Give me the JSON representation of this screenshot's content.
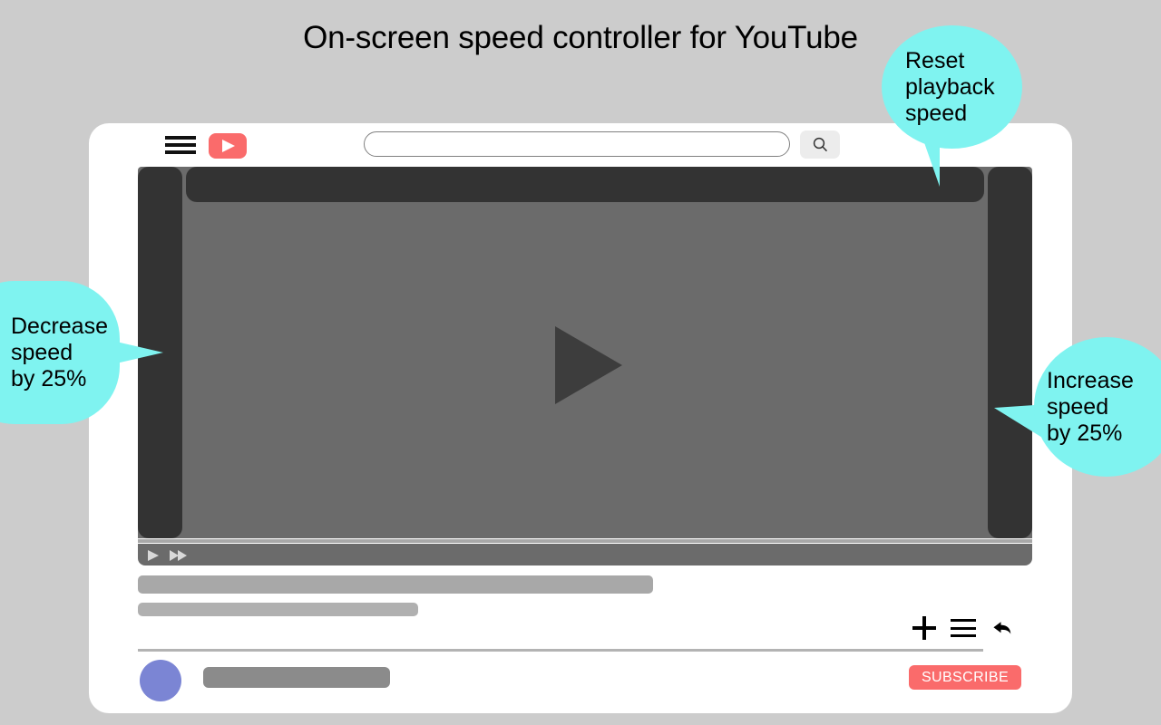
{
  "page": {
    "title": "On-screen speed controller for YouTube",
    "background_color": "#cccccc"
  },
  "colors": {
    "accent_red": "#fa6b6b",
    "callout_cyan": "#7ff3f0",
    "player_dark": "#333333",
    "video_gray": "#6b6b6b",
    "avatar_purple": "#7b85d4"
  },
  "header": {
    "menu_icon": "hamburger-menu-icon",
    "logo_icon": "youtube-logo-icon",
    "search": {
      "value": "",
      "placeholder": ""
    },
    "search_button_icon": "search-icon"
  },
  "player": {
    "play_icon": "play-icon",
    "left_control_icon": "decrease-speed-bar",
    "right_control_icon": "increase-speed-bar",
    "top_control_icon": "reset-speed-bar",
    "controls": {
      "play_icon": "play-icon",
      "fast_forward_icon": "fast-forward-icon"
    }
  },
  "video_meta": {
    "title_placeholder": "",
    "subtitle_placeholder": ""
  },
  "actions": [
    {
      "name": "add-to-playlist",
      "icon": "plus-icon"
    },
    {
      "name": "save-to-list",
      "icon": "list-icon"
    },
    {
      "name": "share",
      "icon": "share-arrow-icon"
    }
  ],
  "channel": {
    "avatar_icon": "avatar-icon",
    "name_placeholder": "",
    "subscribe_label": "SUBSCRIBE"
  },
  "callouts": [
    {
      "id": "reset",
      "text": "Reset\nplayback\nspeed"
    },
    {
      "id": "decrease",
      "text": "Decrease\nspeed\nby 25%"
    },
    {
      "id": "increase",
      "text": "Increase\nspeed\nby 25%"
    }
  ]
}
